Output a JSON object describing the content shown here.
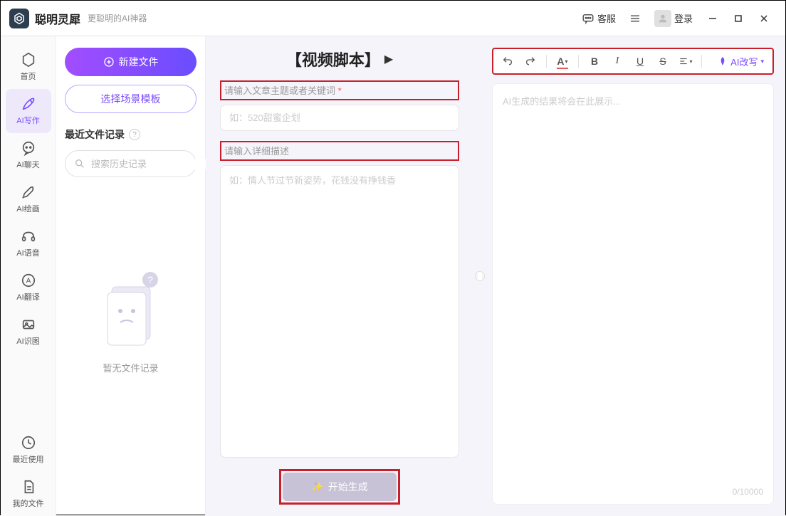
{
  "app": {
    "title": "聪明灵犀",
    "subtitle": "更聪明的AI神器"
  },
  "titlebar": {
    "support": "客服",
    "login": "登录"
  },
  "sidebar": {
    "items": [
      {
        "label": "首页",
        "icon": "home"
      },
      {
        "label": "AI写作",
        "icon": "pen",
        "active": true
      },
      {
        "label": "AI聊天",
        "icon": "chat"
      },
      {
        "label": "AI绘画",
        "icon": "brush"
      },
      {
        "label": "AI语音",
        "icon": "headset"
      },
      {
        "label": "AI翻译",
        "icon": "translate"
      },
      {
        "label": "AI识图",
        "icon": "image"
      }
    ],
    "bottom": [
      {
        "label": "最近使用",
        "icon": "history"
      },
      {
        "label": "我的文件",
        "icon": "file"
      }
    ]
  },
  "filepanel": {
    "new_button": "新建文件",
    "template_button": "选择场景模板",
    "recent_title": "最近文件记录",
    "search_placeholder": "搜索历史记录",
    "empty_text": "暂无文件记录"
  },
  "center": {
    "script_title": "【视频脚本】",
    "topic_label": "请输入文章主题或者关键词",
    "topic_placeholder": "如：520甜蜜企划",
    "detail_label": "请输入详细描述",
    "detail_placeholder": "如：情人节过节新姿势，花钱没有挣钱香",
    "generate_button": "开始生成"
  },
  "right": {
    "result_placeholder": "AI生成的结果将会在此展示...",
    "ai_rewrite": "AI改写",
    "char_count": "0/10000"
  }
}
